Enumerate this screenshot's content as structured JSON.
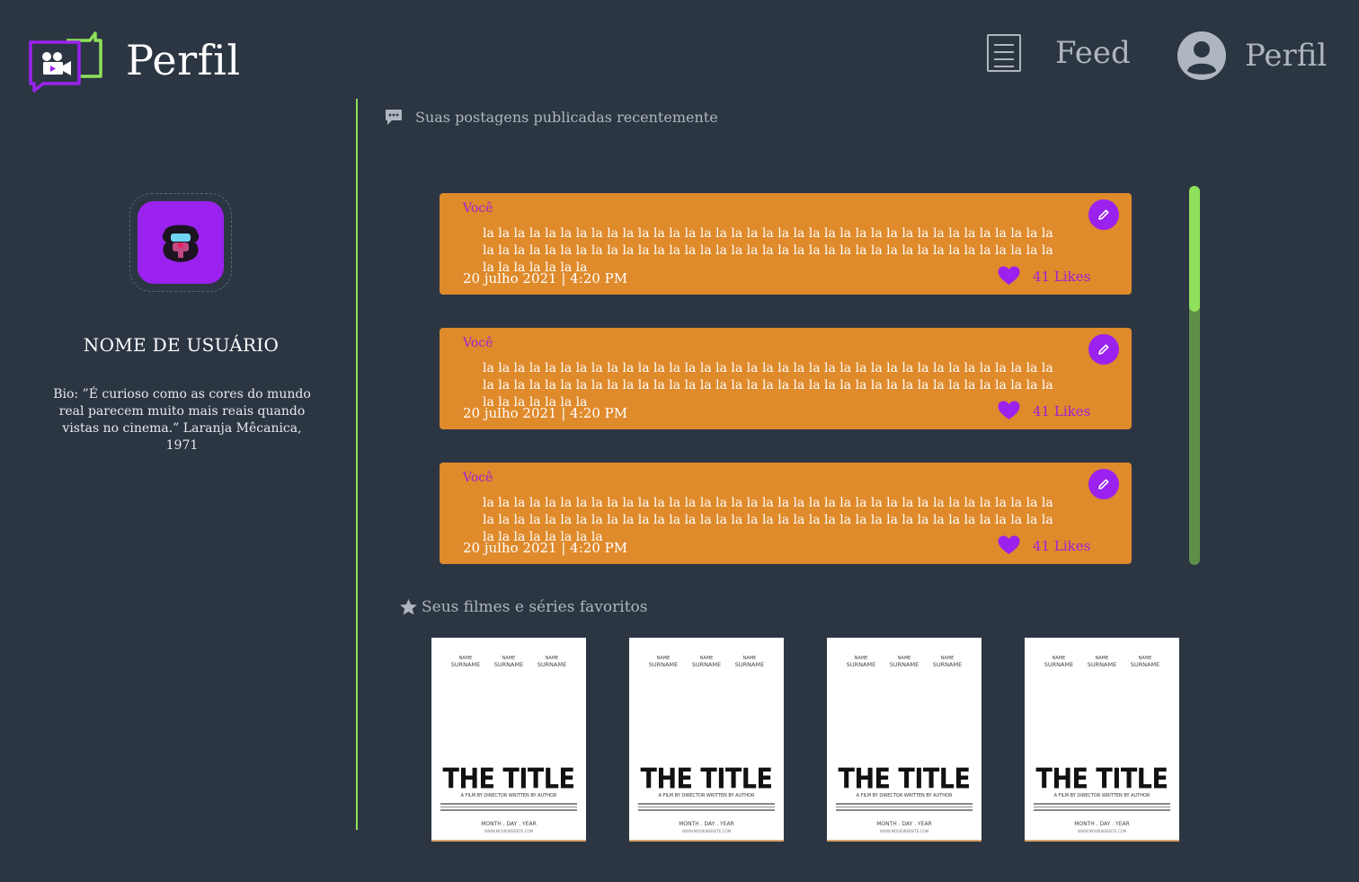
{
  "header": {
    "title": "Perfil",
    "nav": [
      {
        "label": "Feed",
        "icon": "feed-list-icon"
      },
      {
        "label": "Perfil",
        "icon": "user-circle-icon"
      }
    ]
  },
  "profile": {
    "avatar_icon": "garnet-avatar-icon",
    "username": "NOME DE USUÁRIO",
    "bio": "Bio: ”É curioso como as cores do mundo real parecem muito mais reais quando vistas no cinema.” Laranja Mêcanica, 1971"
  },
  "posts_section": {
    "heading": "Suas postagens publicadas recentemente",
    "icon": "chat-bubble-icon"
  },
  "posts": [
    {
      "author": "Você",
      "text": "la la la la la la la la la la la la la la la la la la la la la la la la la la la la la la la la la la la la la la la la la la la la la la la la la la la la la la la la la la la la la la la la la la la la la la la la la la la la la la la la la",
      "date": "20 julho 2021 | 4:20 PM",
      "likes": "41 Likes"
    },
    {
      "author": "Você",
      "text": "la la la la la la la la la la la la la la la la la la la la la la la la la la la la la la la la la la la la la la la la la la la la la la la la la la la la la la la la la la la la la la la la la la la la la la la la la la la la la la la la la",
      "date": "20 julho 2021 | 4:20 PM",
      "likes": "41 Likes"
    },
    {
      "author": "Você",
      "text": "la la la la la la la la la la la la la la la la la la la la la la la la la la la la la la la la la la la la la la la la la la la la la la la la la la la la la la la la la la la la la la la la la la la la la la la la la la la la la la la la la la",
      "date": "20 julho 2021 | 4:20 PM",
      "likes": "41 Likes"
    }
  ],
  "favorites_section": {
    "heading": "Seus filmes e séries favoritos",
    "icon": "star-icon"
  },
  "posters": [
    {
      "names": [
        "NAME",
        "NAME",
        "NAME"
      ],
      "surnames": [
        "SURNAME",
        "SURNAME",
        "SURNAME"
      ],
      "title": "THE TITLE",
      "subtitle": "A FILM BY DIRECTOR WRITTEN BY AUTHOR",
      "date": "MONTH . DAY . YEAR",
      "url": "WWW.MOVIEWEBSITE.COM"
    },
    {
      "names": [
        "NAME",
        "NAME",
        "NAME"
      ],
      "surnames": [
        "SURNAME",
        "SURNAME",
        "SURNAME"
      ],
      "title": "THE TITLE",
      "subtitle": "A FILM BY DIRECTOR WRITTEN BY AUTHOR",
      "date": "MONTH . DAY . YEAR",
      "url": "WWW.MOVIEWEBSITE.COM"
    },
    {
      "names": [
        "NAME",
        "NAME",
        "NAME"
      ],
      "surnames": [
        "SURNAME",
        "SURNAME",
        "SURNAME"
      ],
      "title": "THE TITLE",
      "subtitle": "A FILM BY DIRECTOR WRITTEN BY AUTHOR",
      "date": "MONTH . DAY . YEAR",
      "url": "WWW.MOVIEWEBSITE.COM"
    },
    {
      "names": [
        "NAME",
        "NAME",
        "NAME"
      ],
      "surnames": [
        "SURNAME",
        "SURNAME",
        "SURNAME"
      ],
      "title": "THE TITLE",
      "subtitle": "A FILM BY DIRECTOR WRITTEN BY AUTHOR",
      "date": "MONTH . DAY . YEAR",
      "url": "WWW.MOVIEWEBSITE.COM"
    }
  ],
  "colors": {
    "background": "#2c3643",
    "accent_green": "#8fe05a",
    "accent_purple": "#9b22ee",
    "post_orange": "#df8a2b",
    "muted_text": "#aeb6bf"
  }
}
